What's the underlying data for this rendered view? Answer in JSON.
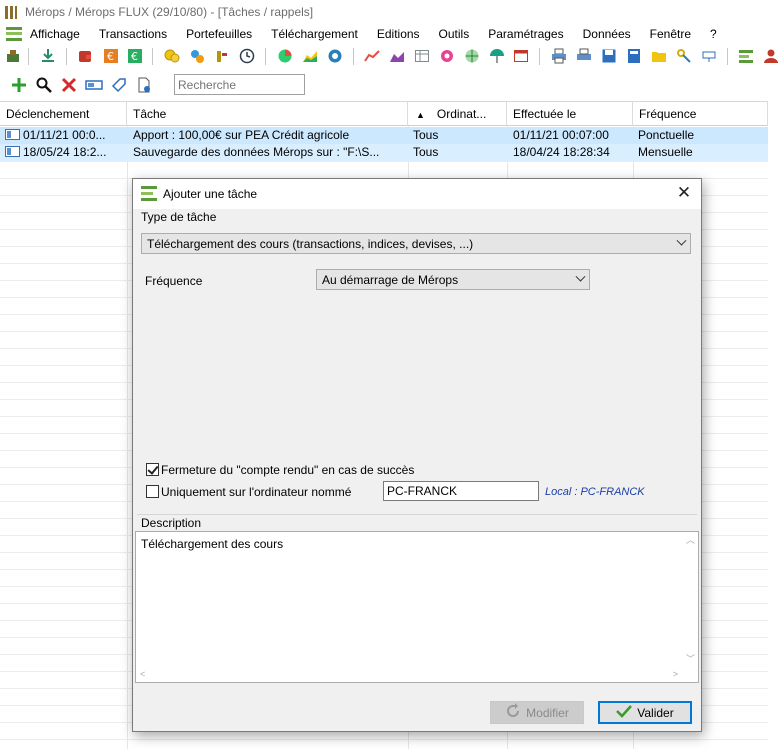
{
  "window": {
    "title": "Mérops / Mérops FLUX (29/10/80) - [Tâches / rappels]"
  },
  "menu": {
    "items": [
      "Affichage",
      "Transactions",
      "Portefeuilles",
      "Téléchargement",
      "Editions",
      "Outils",
      "Paramétrages",
      "Données",
      "Fenêtre",
      "?"
    ]
  },
  "search": {
    "placeholder": "Recherche"
  },
  "grid": {
    "columns": [
      "Déclenchement",
      "Tâche",
      "Ordinat...",
      "Effectuée le",
      "Fréquence"
    ],
    "sort_indicator": "▲",
    "rows": [
      {
        "trigger": "01/11/21 00:0...",
        "task": "Apport : 100,00€ sur PEA Crédit agricole",
        "computer": "Tous",
        "done": "01/11/21 00:07:00",
        "frequency": "Ponctuelle"
      },
      {
        "trigger": "18/05/24 18:2...",
        "task": "Sauvegarde des données Mérops sur : \"F:\\S...",
        "computer": "Tous",
        "done": "18/04/24 18:28:34",
        "frequency": "Mensuelle"
      }
    ]
  },
  "dialog": {
    "title": "Ajouter une tâche",
    "close": "✕",
    "type_label": "Type de tâche",
    "type_value": "Téléchargement des cours (transactions, indices, devises, ...)",
    "freq_label": "Fréquence",
    "freq_value": "Au démarrage de Mérops",
    "close_report_label": "Fermeture du \"compte rendu\" en cas de succès",
    "close_report_checked": true,
    "only_computer_label": "Uniquement sur l'ordinateur nommé",
    "only_computer_checked": false,
    "computer_name": "PC-FRANCK",
    "local_label": "Local : PC-FRANCK",
    "desc_label": "Description",
    "desc_value": "Téléchargement des cours",
    "modify_button": "Modifier",
    "validate_button": "Valider"
  }
}
